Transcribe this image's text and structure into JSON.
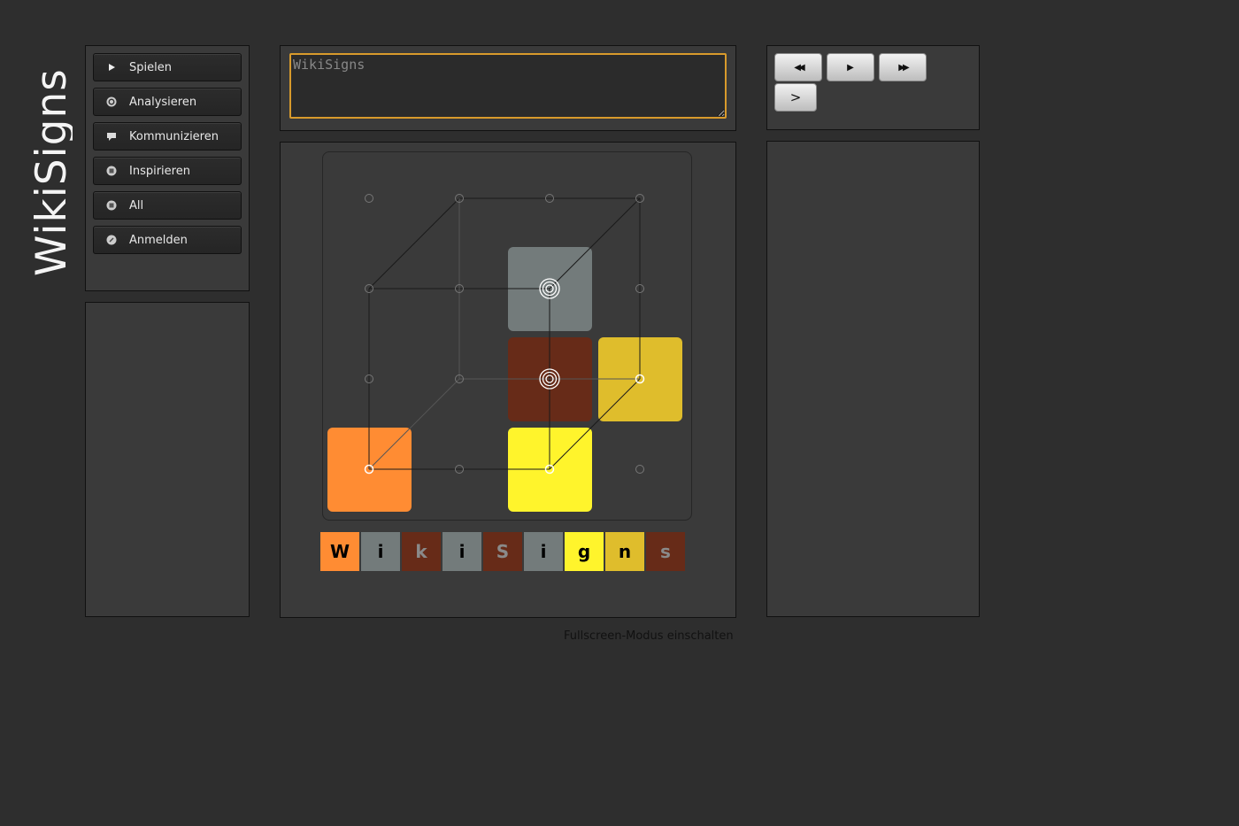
{
  "logo": {
    "text": "WikiSigns"
  },
  "menu": {
    "items": [
      {
        "label": "Spielen",
        "icon": "play-icon"
      },
      {
        "label": "Analysieren",
        "icon": "target-icon"
      },
      {
        "label": "Kommunizieren",
        "icon": "speech-bubble-icon"
      },
      {
        "label": "Inspirieren",
        "icon": "robot-icon"
      },
      {
        "label": "All",
        "icon": "robot-icon"
      },
      {
        "label": "Anmelden",
        "icon": "key-icon"
      }
    ]
  },
  "input": {
    "value": "WikiSigns"
  },
  "controls": {
    "rewind_label": "◀◀",
    "play_label": "▶",
    "forward_label": "▶▶",
    "next_label": ">"
  },
  "board": {
    "colors": {
      "orange": "#ff8c33",
      "gray": "#737b7b",
      "brown": "#672b18",
      "gold": "#dfbd2c",
      "yellow": "#fff42c"
    }
  },
  "tiles": [
    {
      "letter": "W",
      "bg": "#ff8c33",
      "fg": "#000000"
    },
    {
      "letter": "i",
      "bg": "#737b7b",
      "fg": "#000000"
    },
    {
      "letter": "k",
      "bg": "#672b18",
      "fg": "#8a8a8a"
    },
    {
      "letter": "i",
      "bg": "#737b7b",
      "fg": "#000000"
    },
    {
      "letter": "S",
      "bg": "#672b18",
      "fg": "#8a8a8a"
    },
    {
      "letter": "i",
      "bg": "#737b7b",
      "fg": "#000000"
    },
    {
      "letter": "g",
      "bg": "#fff42c",
      "fg": "#000000"
    },
    {
      "letter": "n",
      "bg": "#dfbd2c",
      "fg": "#000000"
    },
    {
      "letter": "s",
      "bg": "#672b18",
      "fg": "#8a8a8a"
    }
  ],
  "footer": {
    "fullscreen_label": "Fullscreen-Modus einschalten"
  }
}
